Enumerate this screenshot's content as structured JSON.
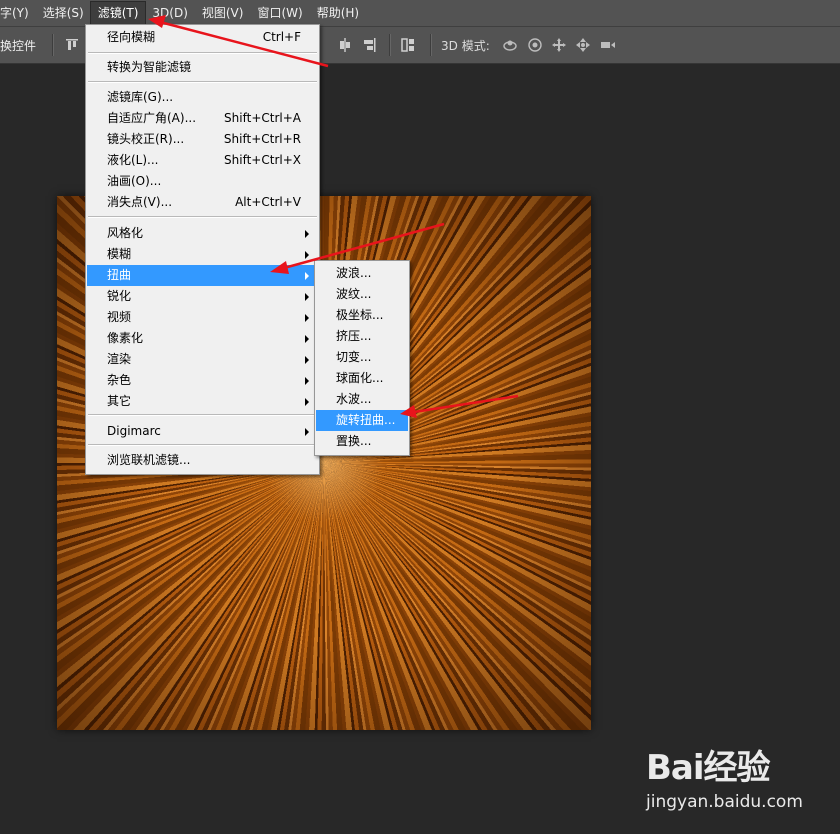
{
  "menubar": {
    "items": [
      {
        "label": "字(Y)"
      },
      {
        "label": "选择(S)"
      },
      {
        "label": "滤镜(T)",
        "active": true
      },
      {
        "label": "3D(D)"
      },
      {
        "label": "视图(V)"
      },
      {
        "label": "窗口(W)"
      },
      {
        "label": "帮助(H)"
      }
    ]
  },
  "optionsbar": {
    "transform_controls_label": "换控件",
    "mode3d_label": "3D 模式:"
  },
  "filter_menu": {
    "items": [
      {
        "label": "径向模糊",
        "shortcut": "Ctrl+F"
      },
      {
        "label": "转换为智能滤镜"
      },
      {
        "label": "滤镜库(G)..."
      },
      {
        "label": "自适应广角(A)...",
        "shortcut": "Shift+Ctrl+A"
      },
      {
        "label": "镜头校正(R)...",
        "shortcut": "Shift+Ctrl+R"
      },
      {
        "label": "液化(L)...",
        "shortcut": "Shift+Ctrl+X"
      },
      {
        "label": "油画(O)..."
      },
      {
        "label": "消失点(V)...",
        "shortcut": "Alt+Ctrl+V"
      },
      {
        "label": "风格化"
      },
      {
        "label": "模糊"
      },
      {
        "label": "扭曲",
        "highlighted": true
      },
      {
        "label": "锐化"
      },
      {
        "label": "视频"
      },
      {
        "label": "像素化"
      },
      {
        "label": "渲染"
      },
      {
        "label": "杂色"
      },
      {
        "label": "其它"
      },
      {
        "label": "Digimarc"
      },
      {
        "label": "浏览联机滤镜..."
      }
    ]
  },
  "distort_submenu": {
    "items": [
      {
        "label": "波浪..."
      },
      {
        "label": "波纹..."
      },
      {
        "label": "极坐标..."
      },
      {
        "label": "挤压..."
      },
      {
        "label": "切变..."
      },
      {
        "label": "球面化..."
      },
      {
        "label": "水波..."
      },
      {
        "label": "旋转扭曲...",
        "highlighted": true
      },
      {
        "label": "置换..."
      }
    ]
  },
  "watermark": {
    "logo": "Bai经验",
    "site": "jingyan.baidu.com"
  },
  "colors": {
    "highlight": "#3399ff",
    "annotation_arrow": "#e8141c",
    "menubar_bg": "#535353",
    "workspace_bg": "#282828"
  }
}
